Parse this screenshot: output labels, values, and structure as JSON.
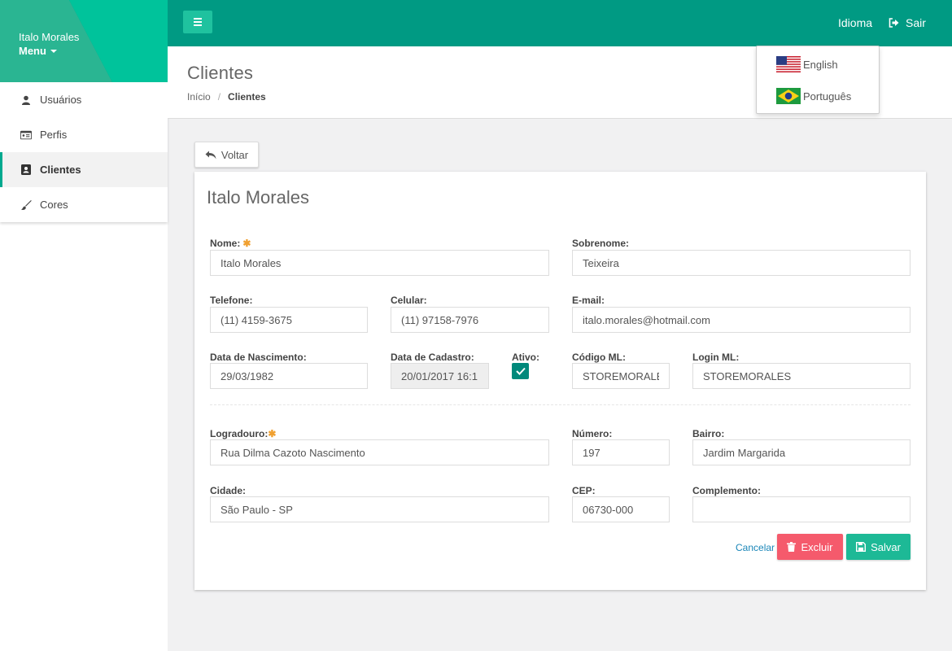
{
  "colors": {
    "primary": "#009a83",
    "accent": "#1fc29f",
    "danger": "#f55a6c",
    "success": "#1db996",
    "link": "#1a86b8"
  },
  "sidebar": {
    "user_name": "Italo Morales",
    "menu_label": "Menu",
    "items": [
      {
        "label": "Usuários",
        "icon": "user-icon"
      },
      {
        "label": "Perfis",
        "icon": "id-card-icon"
      },
      {
        "label": "Clientes",
        "icon": "contact-book-icon",
        "active": true
      },
      {
        "label": "Cores",
        "icon": "paint-brush-icon"
      }
    ]
  },
  "topbar": {
    "idioma_label": "Idioma",
    "sair_label": "Sair"
  },
  "language_menu": [
    {
      "label": "English",
      "icon": "us-flag-icon"
    },
    {
      "label": "Português",
      "icon": "brazil-flag-icon"
    }
  ],
  "header": {
    "title": "Clientes",
    "breadcrumb": [
      "Início",
      "Clientes"
    ],
    "breadcrumb_separator": "/"
  },
  "back_button": "Voltar",
  "form": {
    "title": "Italo Morales",
    "nome": {
      "label": "Nome:",
      "value": "Italo Morales",
      "required": true
    },
    "sobrenome": {
      "label": "Sobrenome:",
      "value": "Teixeira"
    },
    "telefone": {
      "label": "Telefone:",
      "value": "(11) 4159-3675"
    },
    "celular": {
      "label": "Celular:",
      "value": "(11) 97158-7976"
    },
    "email": {
      "label": "E-mail:",
      "value": "italo.morales@hotmail.com"
    },
    "data_nascimento": {
      "label": "Data de Nascimento:",
      "value": "29/03/1982"
    },
    "data_cadastro": {
      "label": "Data de Cadastro:",
      "value": "20/01/2017 16:1"
    },
    "ativo": {
      "label": "Ativo:",
      "checked": true
    },
    "codigo_ml": {
      "label": "Código ML:",
      "value": "STOREMORALES"
    },
    "login_ml": {
      "label": "Login ML:",
      "value": "STOREMORALES"
    },
    "logradouro": {
      "label": "Logradouro:",
      "value": "Rua Dilma Cazoto Nascimento",
      "required": true
    },
    "numero": {
      "label": "Número:",
      "value": "197"
    },
    "bairro": {
      "label": "Bairro:",
      "value": "Jardim Margarida"
    },
    "cidade": {
      "label": "Cidade:",
      "value": "São Paulo - SP"
    },
    "cep": {
      "label": "CEP:",
      "value": "06730-000"
    },
    "complemento": {
      "label": "Complemento:",
      "value": ""
    },
    "required_marker": "✱",
    "actions": {
      "cancel": "Cancelar",
      "delete": "Excluir",
      "save": "Salvar"
    }
  }
}
